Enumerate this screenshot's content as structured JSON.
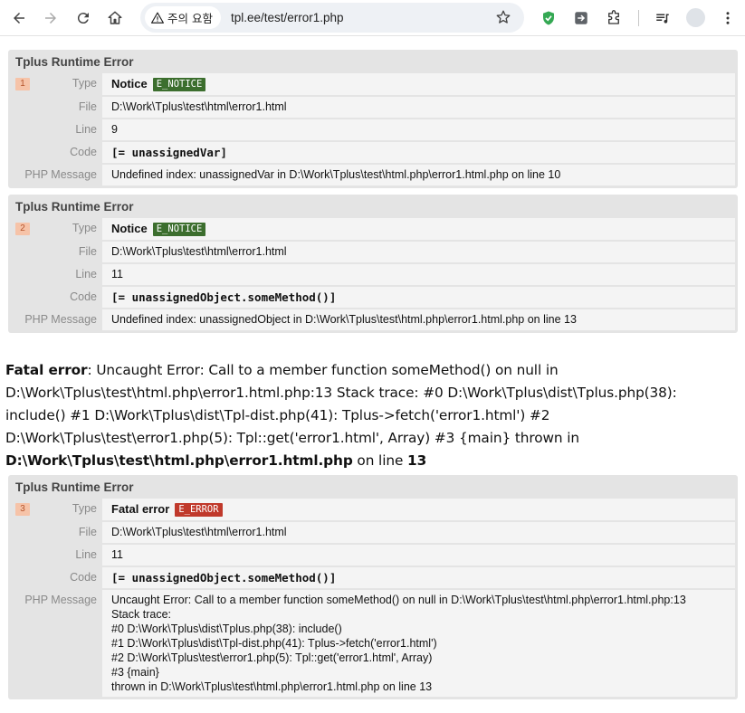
{
  "browser": {
    "security_label": "주의 요함",
    "url": "tpl.ee/test/error1.php"
  },
  "colors": {
    "notice_badge": "#3c6e2e",
    "error_badge": "#c0392b",
    "number_badge_bg": "#f6c3a8",
    "block_bg": "#e4e4e4",
    "value_bg": "#f4f4f4"
  },
  "labels": {
    "title": "Tplus Runtime Error",
    "type": "Type",
    "file": "File",
    "line": "Line",
    "code": "Code",
    "php_message": "PHP Message"
  },
  "errors": [
    {
      "number": "1",
      "type_name": "Notice",
      "badge": "E_NOTICE",
      "file": "D:\\Work\\Tplus\\test\\html\\error1.html",
      "line": "9",
      "code": "[= unassignedVar]",
      "message": "Undefined index: unassignedVar in D:\\Work\\Tplus\\test\\html.php\\error1.html.php on line 10"
    },
    {
      "number": "2",
      "type_name": "Notice",
      "badge": "E_NOTICE",
      "file": "D:\\Work\\Tplus\\test\\html\\error1.html",
      "line": "11",
      "code": "[= unassignedObject.someMethod()]",
      "message": "Undefined index: unassignedObject in D:\\Work\\Tplus\\test\\html.php\\error1.html.php on line 13"
    },
    {
      "number": "3",
      "type_name": "Fatal error",
      "badge": "E_ERROR",
      "file": "D:\\Work\\Tplus\\test\\html\\error1.html",
      "line": "11",
      "code": "[= unassignedObject.someMethod()]",
      "message_lines": [
        "Uncaught Error: Call to a member function someMethod() on null in D:\\Work\\Tplus\\test\\html.php\\error1.html.php:13",
        "Stack trace:",
        "#0 D:\\Work\\Tplus\\dist\\Tplus.php(38): include()",
        "#1 D:\\Work\\Tplus\\dist\\Tpl-dist.php(41): Tplus->fetch('error1.html')",
        "#2 D:\\Work\\Tplus\\test\\error1.php(5): Tpl::get('error1.html', Array)",
        "#3 {main}",
        "thrown in D:\\Work\\Tplus\\test\\html.php\\error1.html.php on line 13"
      ]
    }
  ],
  "fatal": {
    "label": "Fatal error",
    "message": ": Uncaught Error: Call to a member function someMethod() on null in D:\\Work\\Tplus\\test\\html.php\\error1.html.php:13 Stack trace: #0 D:\\Work\\Tplus\\dist\\Tplus.php(38): include() #1 D:\\Work\\Tplus\\dist\\Tpl-dist.php(41): Tplus->fetch('error1.html') #2 D:\\Work\\Tplus\\test\\error1.php(5): Tpl::get('error1.html', Array) #3 {main} thrown in ",
    "file": "D:\\Work\\Tplus\\test\\html.php\\error1.html.php",
    "on_line": " on line ",
    "line": "13"
  }
}
